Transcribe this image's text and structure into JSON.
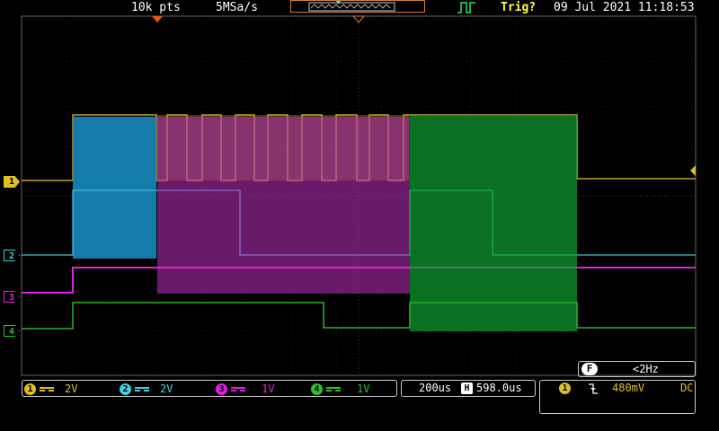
{
  "status_bar": {
    "record_length": "10k pts",
    "sample_rate": "5MSa/s",
    "trigger_status": "Trig?",
    "datetime": "09 Jul 2021 11:18:53"
  },
  "channels": [
    {
      "number": "1",
      "scale": "2V",
      "color": "#e0c020"
    },
    {
      "number": "2",
      "scale": "2V",
      "color": "#40d0e0"
    },
    {
      "number": "3",
      "scale": "1V",
      "color": "#e020e0"
    },
    {
      "number": "4",
      "scale": "1V",
      "color": "#30c030"
    }
  ],
  "horizontal": {
    "timebase": "200us",
    "position": "598.0us"
  },
  "trigger": {
    "frequency_badge": "F",
    "frequency": "<2Hz",
    "source": "1",
    "level": "480mV",
    "coupling": "DC"
  }
}
